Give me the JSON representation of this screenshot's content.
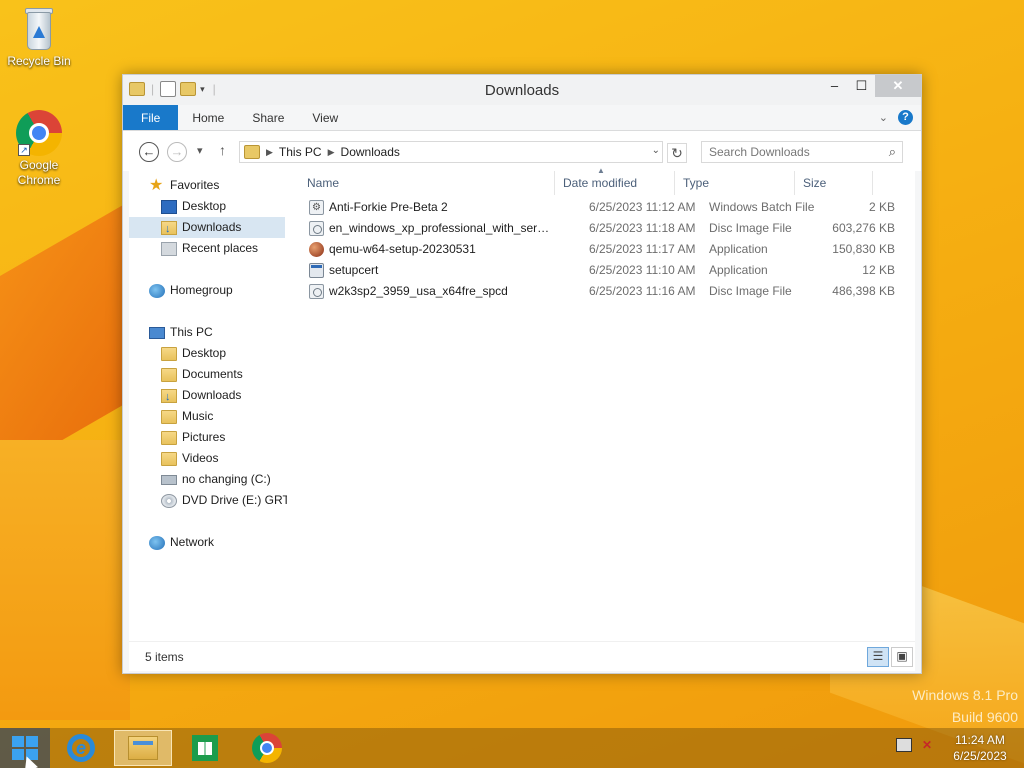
{
  "desktop": {
    "icons": [
      {
        "label": "Recycle Bin",
        "icon": "recycle-bin-icon"
      },
      {
        "label": "Google Chrome",
        "icon": "chrome-icon"
      }
    ],
    "watermark_line1": "Windows 8.1 Pro",
    "watermark_line2": "Build 9600"
  },
  "window": {
    "title": "Downloads",
    "controls": {
      "minimize": "–",
      "maximize": "☐",
      "close": "✕"
    }
  },
  "ribbon": {
    "tabs": [
      {
        "label": "File",
        "active": true
      },
      {
        "label": "Home"
      },
      {
        "label": "Share"
      },
      {
        "label": "View"
      }
    ]
  },
  "address": {
    "crumbs": [
      "This PC",
      "Downloads"
    ],
    "search_placeholder": "Search Downloads"
  },
  "nav": {
    "favorites": "Favorites",
    "fav_items": [
      "Desktop",
      "Downloads",
      "Recent places"
    ],
    "homegroup": "Homegroup",
    "thispc": "This PC",
    "pc_items": [
      "Desktop",
      "Documents",
      "Downloads",
      "Music",
      "Pictures",
      "Videos",
      "no changing (C:)",
      "DVD Drive (E:) GRTM"
    ],
    "network": "Network",
    "selected": "Downloads"
  },
  "columns": {
    "name": "Name",
    "date": "Date modified",
    "type": "Type",
    "size": "Size"
  },
  "files": [
    {
      "name": "Anti-Forkie Pre-Beta 2",
      "date": "6/25/2023 11:12 AM",
      "type": "Windows Batch File",
      "size": "2 KB",
      "icon": "batch-file-icon"
    },
    {
      "name": "en_windows_xp_professional_with_servic...",
      "date": "6/25/2023 11:18 AM",
      "type": "Disc Image File",
      "size": "603,276 KB",
      "icon": "disc-image-icon"
    },
    {
      "name": "qemu-w64-setup-20230531",
      "date": "6/25/2023 11:17 AM",
      "type": "Application",
      "size": "150,830 KB",
      "icon": "qemu-app-icon"
    },
    {
      "name": "setupcert",
      "date": "6/25/2023 11:10 AM",
      "type": "Application",
      "size": "12 KB",
      "icon": "application-icon"
    },
    {
      "name": "w2k3sp2_3959_usa_x64fre_spcd",
      "date": "6/25/2023 11:16 AM",
      "type": "Disc Image File",
      "size": "486,398 KB",
      "icon": "disc-image-icon"
    }
  ],
  "status": {
    "items": "5 items"
  },
  "taskbar": {
    "apps": [
      "Internet Explorer",
      "File Explorer",
      "Store",
      "Google Chrome"
    ],
    "time": "11:24 AM",
    "date": "6/25/2023"
  }
}
